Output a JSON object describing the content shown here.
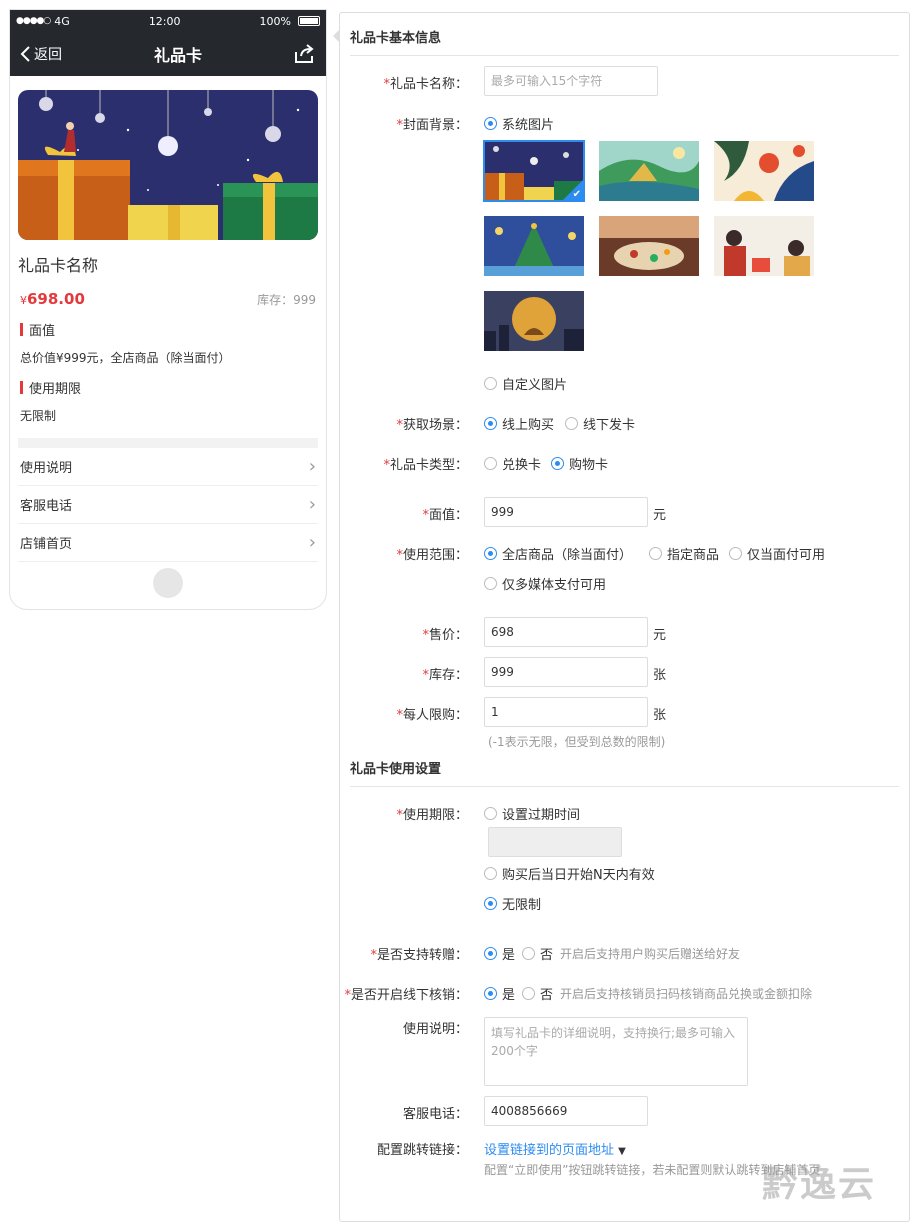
{
  "phone": {
    "status": {
      "carrier": "4G",
      "time": "12:00",
      "battery": "100%"
    },
    "nav": {
      "back_label": "返回",
      "title": "礼品卡"
    },
    "card_name": "礼品卡名称",
    "price_symbol": "¥",
    "price": "698.00",
    "stock_label": "库存：999",
    "face_value_title": "面值",
    "face_value_text": "总价值¥999元，全店商品（除当面付）",
    "validity_title": "使用期限",
    "validity_text": "无限制",
    "links": [
      {
        "label": "使用说明"
      },
      {
        "label": "客服电话"
      },
      {
        "label": "店铺首页"
      }
    ]
  },
  "form": {
    "section1_title": "礼品卡基本信息",
    "section2_title": "礼品卡使用设置",
    "name": {
      "label": "礼品卡名称：",
      "placeholder": "最多可输入15个字符"
    },
    "cover": {
      "label": "封面背景：",
      "option_system": "系统图片",
      "option_custom": "自定义图片",
      "selected_index": 0
    },
    "scene": {
      "label": "获取场景：",
      "options": [
        "线上购买",
        "线下发卡"
      ],
      "selected": "线上购买"
    },
    "type": {
      "label": "礼品卡类型：",
      "options": [
        "兑换卡",
        "购物卡"
      ],
      "selected": "购物卡"
    },
    "face_value": {
      "label": "面值：",
      "value": "999",
      "unit": "元"
    },
    "scope": {
      "label": "使用范围：",
      "options": [
        "全店商品（除当面付）",
        "指定商品",
        "仅当面付可用",
        "仅多媒体支付可用"
      ],
      "selected": "全店商品（除当面付）"
    },
    "price": {
      "label": "售价：",
      "value": "698",
      "unit": "元"
    },
    "stock": {
      "label": "库存：",
      "value": "999",
      "unit": "张"
    },
    "limit": {
      "label": "每人限购：",
      "value": "1",
      "unit": "张",
      "hint": "(-1表示无限，但受到总数的限制)"
    },
    "validity": {
      "label": "使用期限：",
      "options": [
        "设置过期时间",
        "购买后当日开始N天内有效",
        "无限制"
      ],
      "selected": "无限制"
    },
    "transfer": {
      "label": "是否支持转赠：",
      "yes": "是",
      "no": "否",
      "hint": "开启后支持用户购买后赠送给好友",
      "selected": "是"
    },
    "offline": {
      "label": "是否开启线下核销：",
      "yes": "是",
      "no": "否",
      "hint": "开启后支持核销员扫码核销商品兑换或金额扣除",
      "selected": "是"
    },
    "instructions": {
      "label": "使用说明：",
      "placeholder": "填写礼品卡的详细说明，支持换行;最多可输入200个字"
    },
    "phone": {
      "label": "客服电话：",
      "value": "4008856669"
    },
    "jump": {
      "label": "配置跳转链接：",
      "link": "设置链接到的页面地址",
      "hint": "配置“立即使用”按钮跳转链接，若未配置则默认跳转到店铺首页"
    }
  },
  "watermark": "黔逸云",
  "colors": {
    "accent": "#2d8cf0",
    "price_red": "#e4393c",
    "header_dark": "#25292e"
  }
}
